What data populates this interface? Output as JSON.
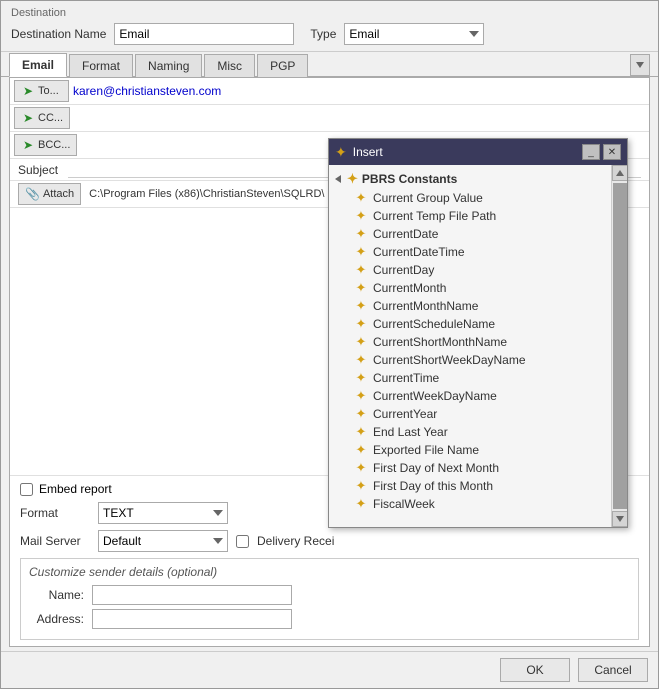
{
  "window": {
    "destination_section_label": "Destination",
    "destination_name_label": "Destination Name",
    "destination_name_value": "Email",
    "type_label": "Type",
    "type_value": "Email"
  },
  "tabs": [
    {
      "label": "Email",
      "active": true
    },
    {
      "label": "Format",
      "active": false
    },
    {
      "label": "Naming",
      "active": false
    },
    {
      "label": "Misc",
      "active": false
    },
    {
      "label": "PGP",
      "active": false
    }
  ],
  "email": {
    "to_label": "To...",
    "to_value": "karen@christiansteven.com",
    "cc_label": "CC...",
    "cc_value": "",
    "bcc_label": "BCC...",
    "bcc_value": "",
    "subject_label": "Subject",
    "subject_value": "",
    "attach_label": "Attach",
    "attach_path": "C:\\Program Files (x86)\\ChristianSteven\\SQLRD\\"
  },
  "options": {
    "embed_label": "Embed report",
    "format_label": "Format",
    "format_value": "TEXT",
    "mail_server_label": "Mail Server",
    "mail_server_value": "Default",
    "delivery_label": "Delivery Recei",
    "sender_label": "Customize sender details (optional)",
    "name_label": "Name:",
    "name_value": "",
    "address_label": "Address:",
    "address_value": ""
  },
  "footer": {
    "ok_label": "OK",
    "cancel_label": "Cancel"
  },
  "insert_popup": {
    "title": "Insert",
    "root_label": "PBRS Constants",
    "items": [
      "Current Group Value",
      "Current Temp File Path",
      "CurrentDate",
      "CurrentDateTime",
      "CurrentDay",
      "CurrentMonth",
      "CurrentMonthName",
      "CurrentScheduleName",
      "CurrentShortMonthName",
      "CurrentShortWeekDayName",
      "CurrentTime",
      "CurrentWeekDayName",
      "CurrentYear",
      "End Last Year",
      "Exported File Name",
      "First Day of Next Month",
      "First Day of this Month",
      "FiscalWeek"
    ]
  }
}
